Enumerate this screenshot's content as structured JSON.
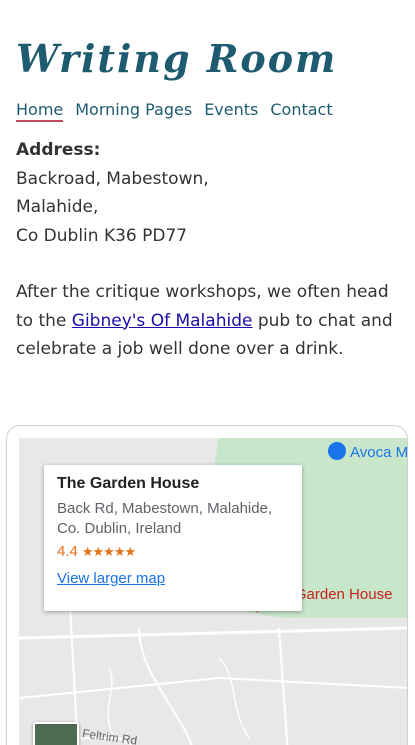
{
  "site": {
    "title": "Writing Room"
  },
  "nav": [
    {
      "label": "Home"
    },
    {
      "label": "Morning Pages"
    },
    {
      "label": "Events"
    },
    {
      "label": "Contact"
    }
  ],
  "address": {
    "label": "Address:",
    "line1": "Backroad, Mabestown,",
    "line2": "Malahide,",
    "line3": "Co Dublin K36 PD77"
  },
  "paragraph": {
    "before": "After the critique workshops, we often head to the ",
    "link": "Gibney's Of Malahide",
    "after": " pub to chat and celebrate a job well done over a drink."
  },
  "map": {
    "place_name": "The Garden House",
    "place_address": "Back Rd, Mabestown, Malahide, Co. Dublin, Ireland",
    "rating": "4.4",
    "stars": "★★★★★",
    "view_larger": "View larger map",
    "marker_label": "he Garden House",
    "avoca_label": "Avoca M",
    "road_label": "Feltrim Rd",
    "colors": {
      "park": "#c8e6c9",
      "road": "#ffffff",
      "marker": "#ea4335"
    }
  }
}
